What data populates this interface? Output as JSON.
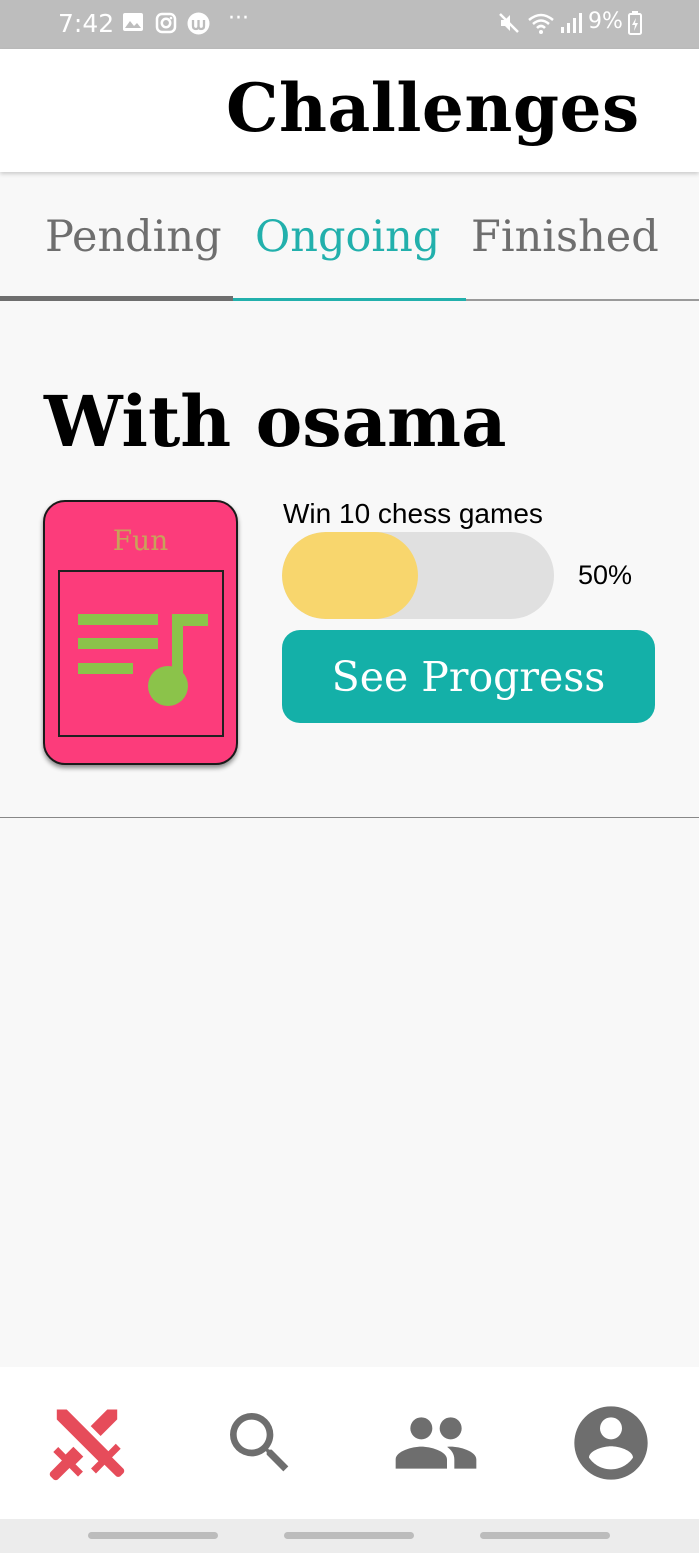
{
  "status_bar": {
    "time": "7:42",
    "battery": "9%",
    "icons": [
      "gallery-icon",
      "instagram-icon",
      "app-notification-icon",
      "more-dots-icon",
      "mute-icon",
      "wifi-icon",
      "signal-icon",
      "battery-icon"
    ],
    "more": "···"
  },
  "header": {
    "title": "Challenges"
  },
  "tabs": [
    {
      "label": "Pending"
    },
    {
      "label": "Ongoing",
      "active": true
    },
    {
      "label": "Finished"
    }
  ],
  "challenge": {
    "heading": "With osama",
    "category": {
      "label": "Fun",
      "icon": "playlist-music-icon"
    },
    "goal": "Win 10 chess games",
    "progress": 0.5,
    "progress_label": "50%",
    "button_label": "See Progress"
  },
  "bottom_nav": [
    {
      "name": "challenges",
      "icon": "crossed-swords-icon",
      "active": true
    },
    {
      "name": "search",
      "icon": "search-icon"
    },
    {
      "name": "friends",
      "icon": "people-icon"
    },
    {
      "name": "profile",
      "icon": "account-circle-icon"
    }
  ],
  "colors": {
    "accent": "#22b0ac",
    "button": "#14b0a8",
    "progress_fill": "#f8d66d",
    "progress_track": "#e0e0e0",
    "category_card": "#fc3c7b",
    "category_icon": "#8bc34a",
    "nav_active": "#e64c5a",
    "nav_inactive": "#6e6e6e"
  }
}
